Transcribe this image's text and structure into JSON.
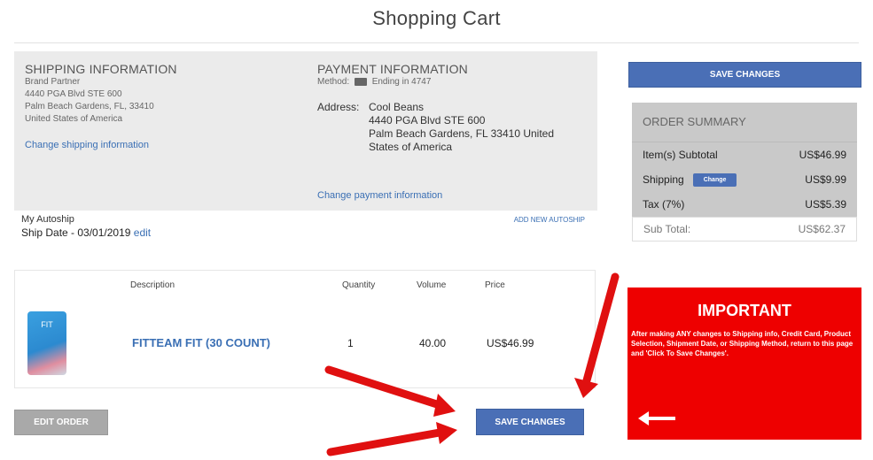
{
  "page": {
    "title": "Shopping Cart"
  },
  "shipping": {
    "heading": "SHIPPING INFORMATION",
    "name": "Brand Partner",
    "line1": "4440 PGA Blvd STE 600",
    "line2": "Palm Beach Gardens, FL, 33410",
    "country": "United States of America",
    "change_link": "Change shipping information"
  },
  "payment": {
    "heading": "PAYMENT INFORMATION",
    "method_label": "Method:",
    "method_value": "Ending in 4747",
    "address_label": "Address:",
    "address_lines": [
      "Cool Beans",
      "4440 PGA Blvd STE 600",
      "Palm Beach Gardens, FL 33410 United",
      "States of America"
    ],
    "change_link": "Change payment information"
  },
  "autoship": {
    "label": "My Autoship",
    "ship_date": "Ship Date - 03/01/2019",
    "edit_link": "edit",
    "add_new": "ADD NEW AUTOSHIP"
  },
  "buttons": {
    "save_top": "SAVE CHANGES",
    "save_bottom": "SAVE CHANGES",
    "edit_order": "EDIT ORDER"
  },
  "summary": {
    "heading": "ORDER SUMMARY",
    "subtotal_label": "Item(s) Subtotal",
    "subtotal_value": "US$46.99",
    "shipping_label": "Shipping",
    "shipping_button": "Change",
    "shipping_value": "US$9.99",
    "tax_label": "Tax (7%)",
    "tax_value": "US$5.39",
    "total_label": "Sub Total:",
    "total_value": "US$62.37"
  },
  "cart": {
    "headers": {
      "description": "Description",
      "quantity": "Quantity",
      "volume": "Volume",
      "price": "Price"
    },
    "item": {
      "thumb_label": "FIT",
      "name": "FITTEAM FIT (30 COUNT)",
      "quantity": "1",
      "volume": "40.00",
      "price": "US$46.99"
    }
  },
  "important": {
    "title": "IMPORTANT",
    "text": "After making ANY changes to Shipping info, Credit Card, Product Selection, Shipment Date, or Shipping Method, return to this page and 'Click To Save Changes'."
  },
  "colors": {
    "accent": "#4a6fb6",
    "link": "#3a6fb4",
    "alert": "#ee0000",
    "annotation_arrow": "#e01010"
  }
}
